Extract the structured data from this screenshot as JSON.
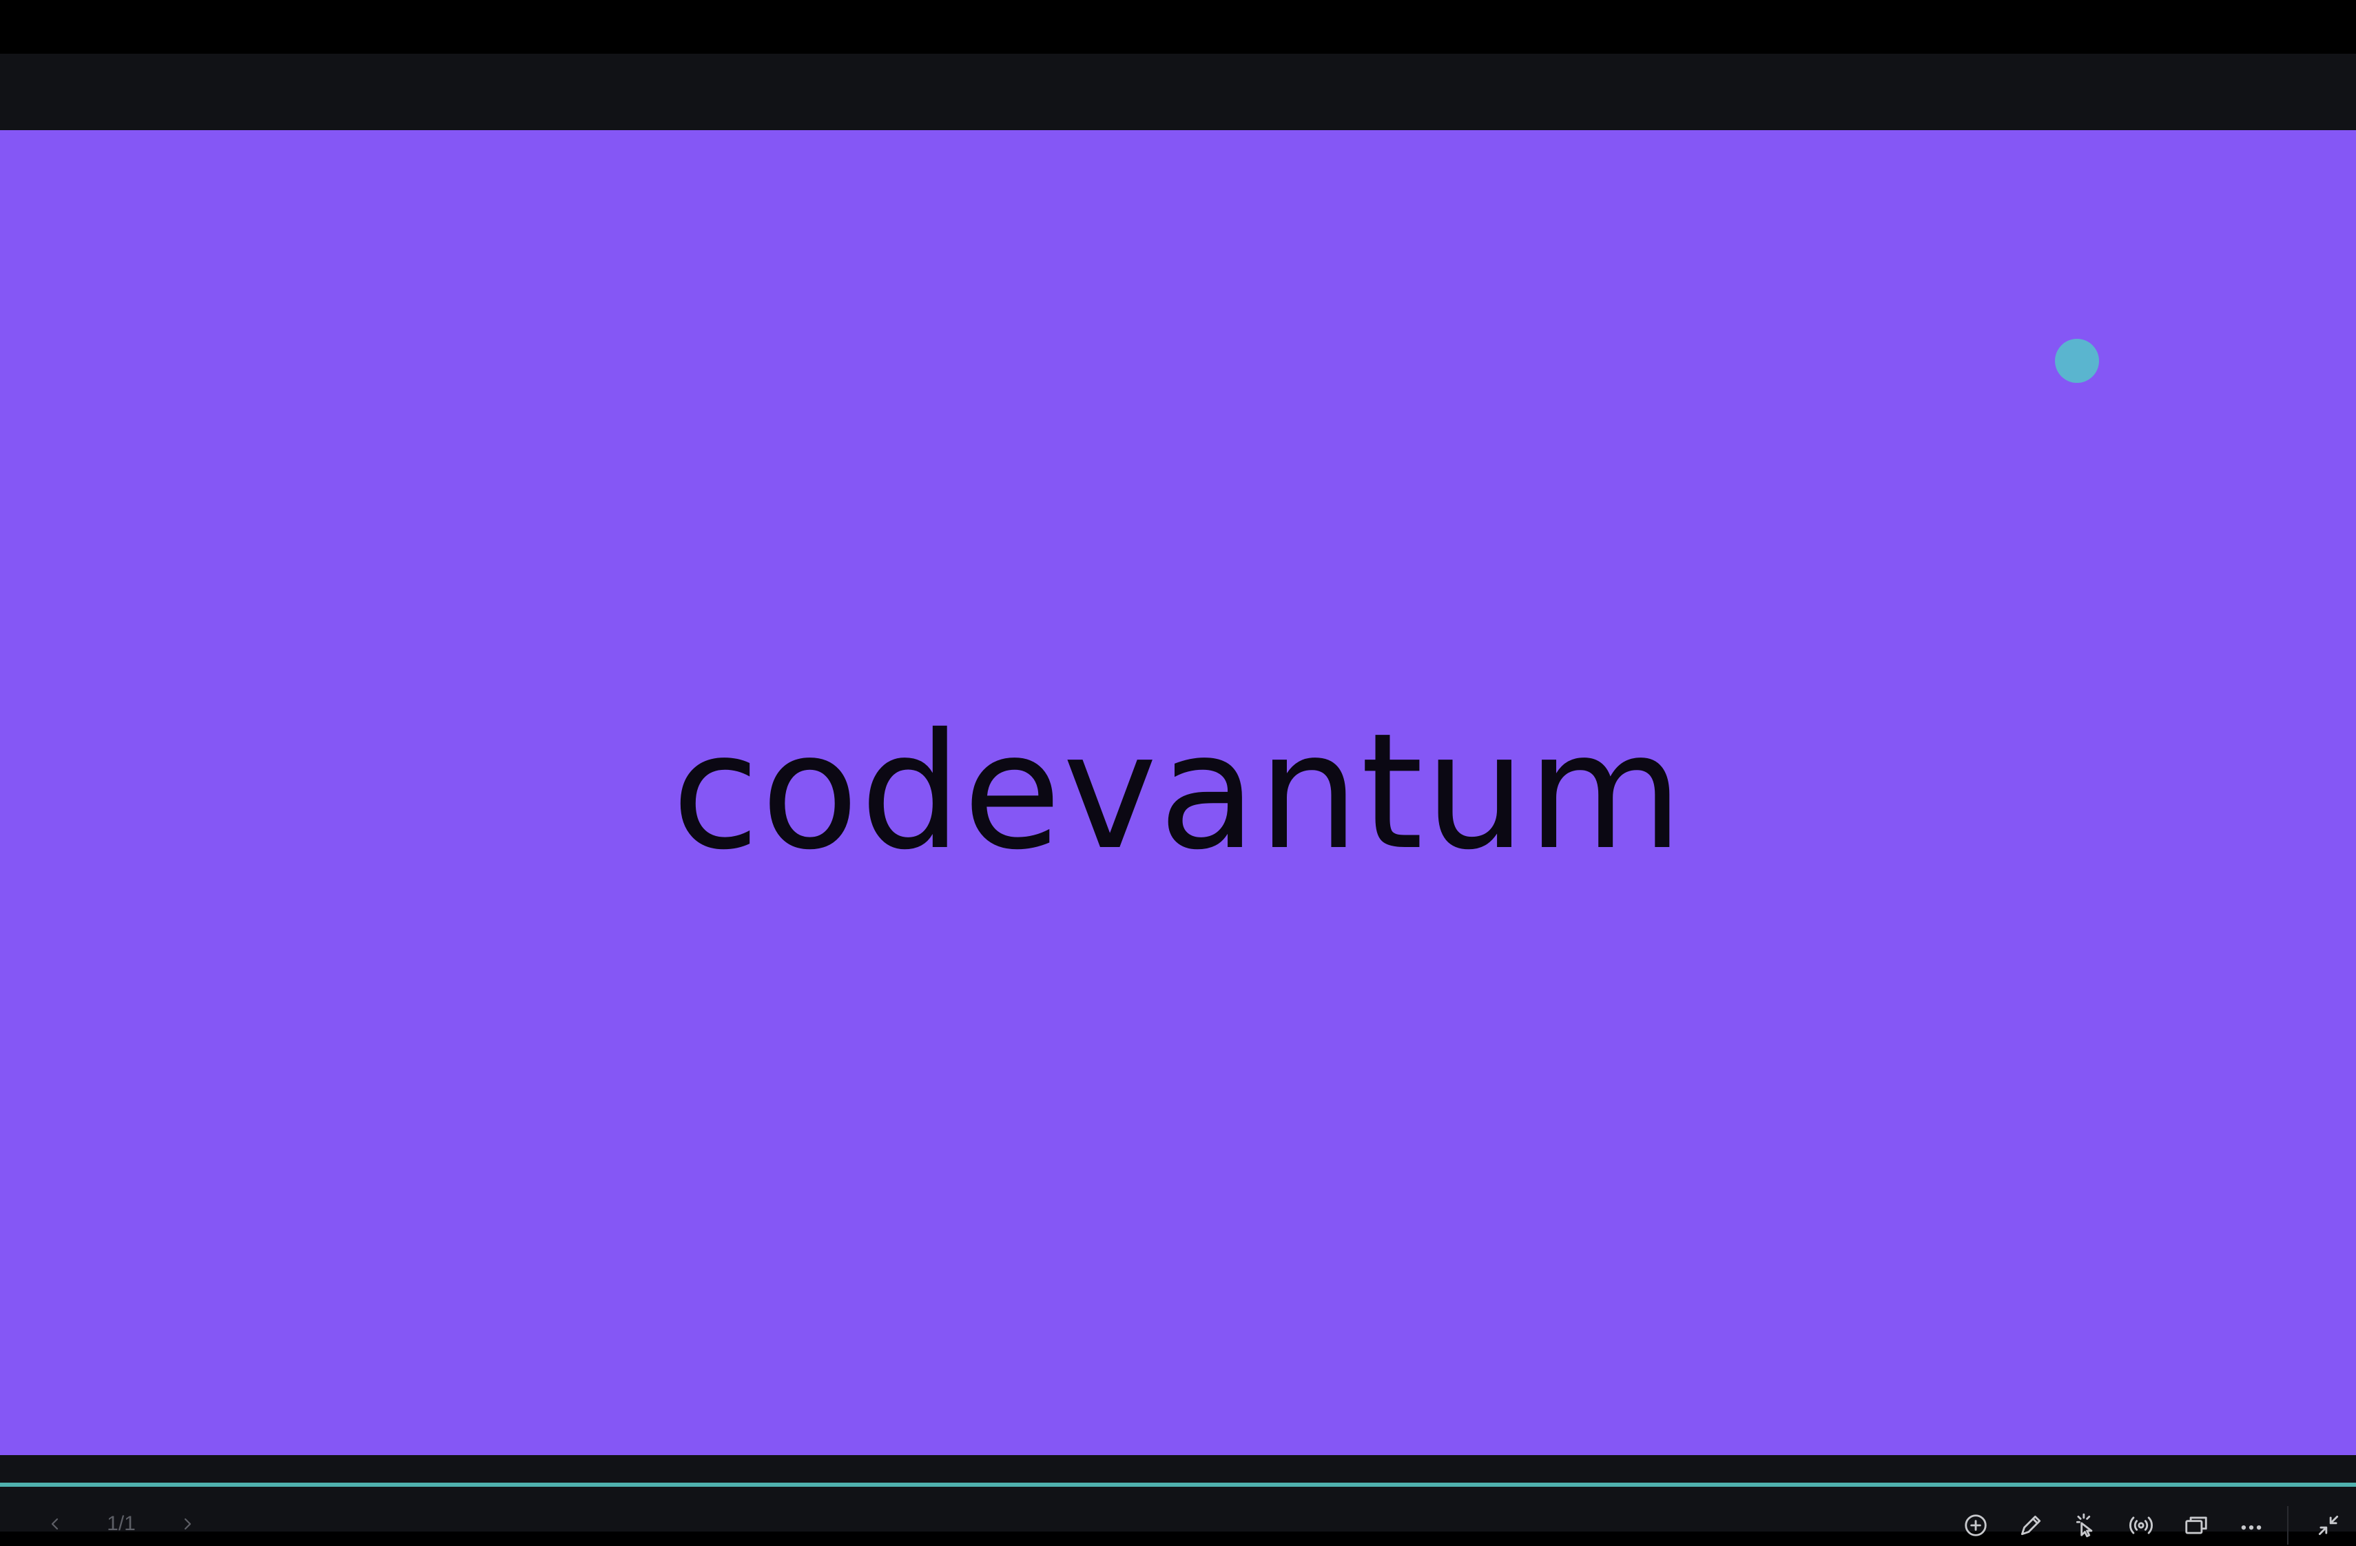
{
  "slide": {
    "title": "codevantum",
    "background_color": "#8557f5",
    "text_color": "#0b0813",
    "cursor_dot_color": "#5ab5cf"
  },
  "chrome": {
    "bar_color": "#111216",
    "accent_color": "#4fb1ae"
  },
  "navigation": {
    "prev_icon": "chevron-left-icon",
    "next_icon": "chevron-right-icon",
    "page_counter": "1/1",
    "progress_fraction": 1.0
  },
  "toolbar": {
    "icons": [
      "zoom-in-icon",
      "pen-icon",
      "laser-pointer-icon",
      "broadcast-icon",
      "presenter-view-icon",
      "more-icon",
      "exit-fullscreen-icon"
    ]
  }
}
